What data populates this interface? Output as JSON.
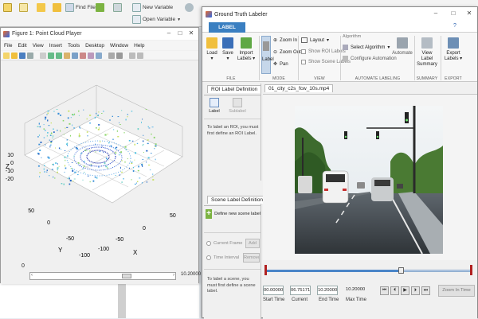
{
  "background": {
    "toolbar": {
      "find_files": "Find Files",
      "new_variable": "New Variable",
      "open_variable": "Open Variable"
    }
  },
  "point_cloud_player": {
    "title": "Figure 1: Point Cloud Player",
    "menu": [
      "File",
      "Edit",
      "View",
      "Insert",
      "Tools",
      "Desktop",
      "Window",
      "Help"
    ],
    "axis": {
      "z_label": "Z",
      "y_label": "Y",
      "x_label": "X",
      "z_ticks": [
        "10",
        "0",
        "-10",
        "-20"
      ],
      "y_ticks": [
        "50",
        "0",
        "-50",
        "-100"
      ],
      "x_ticks": [
        "-100",
        "-50",
        "0",
        "50"
      ]
    },
    "slider": {
      "min_label": "0",
      "max_label": "10.20000",
      "value_fraction": 0.68
    }
  },
  "ground_truth_labeler": {
    "title": "Ground Truth Labeler",
    "tab": "LABEL",
    "ribbon": {
      "load": "Load",
      "save": "Save",
      "import_labels": "Import Labels",
      "label": "Label",
      "zoom_in": "Zoom In",
      "zoom_out": "Zoom Out",
      "pan": "Pan",
      "layout": "Layout",
      "show_roi_labels": "Show ROI Labels",
      "show_scene_labels": "Show Scene Labels",
      "algorithm_heading": "Algorithm",
      "select_algorithm": "Select Algorithm",
      "configure_automation": "Configure Automation",
      "automate": "Automate",
      "view_label_summary": "View Label Summary",
      "export_labels": "Export Labels",
      "sections": {
        "file": "FILE",
        "mode": "MODE",
        "view": "VIEW",
        "automate_labeling": "AUTOMATE LABELING",
        "summary": "SUMMARY",
        "export": "EXPORT"
      }
    },
    "roi_panel": {
      "tab": "ROI Label Definition",
      "label_btn": "Label",
      "sublabel_btn": "Sublabel",
      "help": "To label an ROI, you must first define an ROI Label."
    },
    "scene_panel": {
      "tab": "Scene Label Definition",
      "define_btn": "Define new scene label",
      "current_frame": "Current Frame",
      "time_interval": "Time Interval",
      "add_btn": "Add",
      "remove_btn": "Remove",
      "help": "To label a scene, you must first define a scene label."
    },
    "video": {
      "tab": "01_city_c2s_fcw_10s.mp4"
    },
    "timeline": {
      "start_time": "00.00000",
      "current": "06.75171",
      "end_time": "10.20000",
      "max_time": "10.20000",
      "start_label": "Start Time",
      "current_label": "Current",
      "end_label": "End Time",
      "max_label": "Max Time",
      "zoom_in_time": "Zoom In Time",
      "progress_fraction": 0.66
    }
  }
}
